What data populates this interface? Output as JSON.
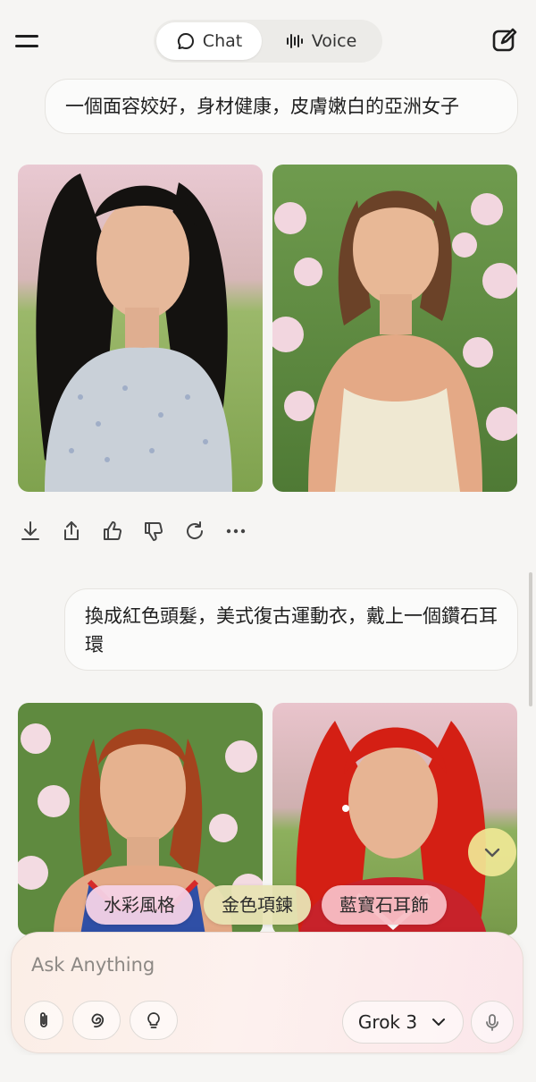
{
  "header": {
    "tabs": [
      {
        "label": "Chat",
        "icon": "chat-bubble-icon",
        "active": true
      },
      {
        "label": "Voice",
        "icon": "voice-waveform-icon",
        "active": false
      }
    ]
  },
  "messages": {
    "first_prompt": "一個面容姣好，身材健康，皮膚嫩白的亞洲女子",
    "second_prompt": "換成紅色頭髮，美式復古運動衣，戴上一個鑽石耳環"
  },
  "response_actions": [
    "download-icon",
    "share-icon",
    "thumbs-up-icon",
    "thumbs-down-icon",
    "regenerate-icon",
    "more-icon"
  ],
  "suggestions": [
    "水彩風格",
    "金色項鍊",
    "藍寶石耳飾"
  ],
  "composer": {
    "placeholder": "Ask Anything",
    "model": "Grok 3"
  },
  "colors": {
    "background": "#f6f5f3",
    "bubble": "#fbfbfa",
    "scroll_button": "#f0e896",
    "chip_pink": "#f4d2e6",
    "chip_gold": "#e8e4b4",
    "chip_red": "#f8bec4"
  }
}
